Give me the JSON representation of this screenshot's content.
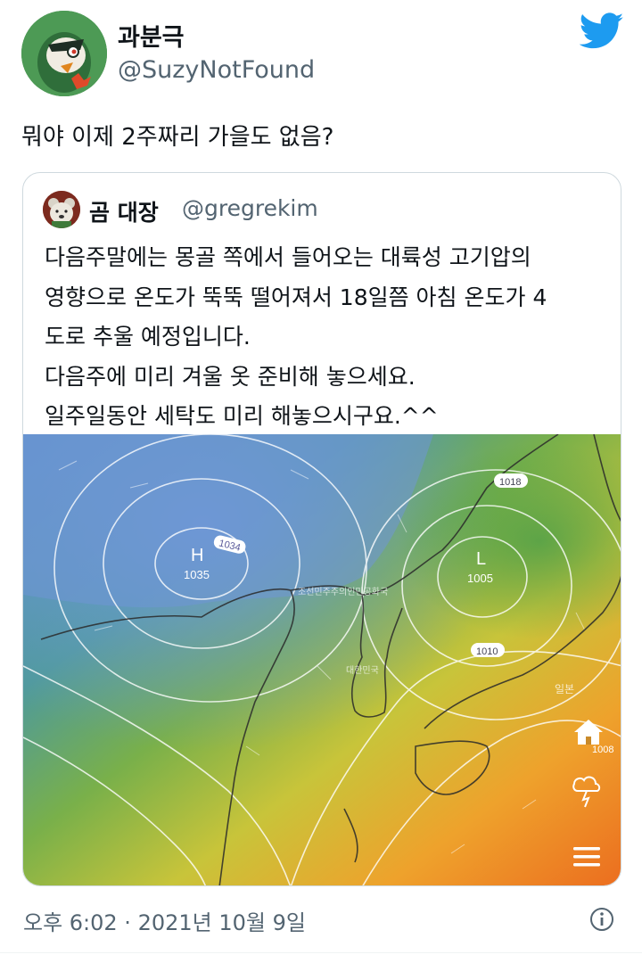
{
  "author": {
    "name": "과분극",
    "handle": "@SuzyNotFound",
    "avatar_icon": "avatar-character-icon"
  },
  "tweet": {
    "text": "뭐야 이제 2주짜리 가을도 없음?"
  },
  "quoted": {
    "name": "곰 대장",
    "handle": "@gregrekim",
    "lines": [
      "다음주말에는 몽골 쪽에서 들어오는 대륙성 고기압의",
      "영향으로 온도가 뚝뚝 떨어져서 18일쯤 아침 온도가 4",
      "도로 추울 예정입니다.",
      "다음주에 미리 겨울 옷 준비해 놓으세요.",
      "일주일동안 세탁도 미리 해놓으시구요.^^"
    ]
  },
  "map": {
    "high_marker": "H",
    "high_value": "1035",
    "isobar_high": "1034",
    "low_marker": "L",
    "low_value": "1005",
    "isobar_1018": "1018",
    "isobar_1010": "1010",
    "isobar_1008": "1008",
    "label_north_korea": "조선민주주의인민공화국",
    "label_korea": "대한민국",
    "label_japan": "일본"
  },
  "footer": {
    "timestamp": "오후 6:02 · 2021년 10월 9일"
  },
  "colors": {
    "twitter_blue": "#1d9bf0",
    "text_secondary": "#536471",
    "border": "#cfd9de"
  }
}
